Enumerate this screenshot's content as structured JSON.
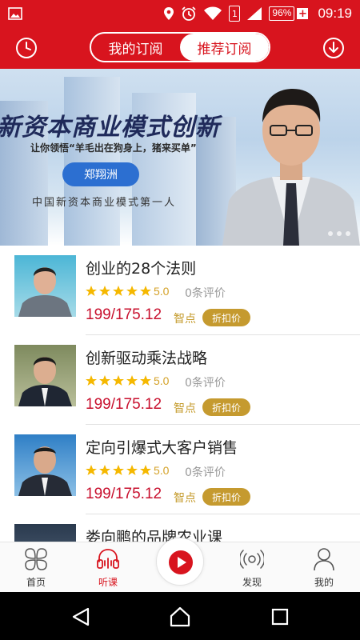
{
  "status_bar": {
    "battery": "96%",
    "battery_plus": "+",
    "sim": "1",
    "time": "09:19"
  },
  "header": {
    "tabs": {
      "mine": "我的订阅",
      "recommended": "推荐订阅"
    },
    "active_tab": "recommended",
    "left_icon": "clock-icon",
    "right_icon": "download-icon"
  },
  "banner": {
    "title": "新资本商业模式创新",
    "subtitle": "让你领悟“羊毛出在狗身上，猪来买单”",
    "speaker": "郑翔洲",
    "slogan": "中国新资本商业模式第一人",
    "slides": 3
  },
  "courses": [
    {
      "title": "创业的28个法则",
      "rating": "5.0",
      "stars": 5,
      "reviews": "0条评价",
      "price": "199/175.12",
      "unit": "智点",
      "badge": "折扣价"
    },
    {
      "title": "创新驱动乘法战略",
      "rating": "5.0",
      "stars": 5,
      "reviews": "0条评价",
      "price": "199/175.12",
      "unit": "智点",
      "badge": "折扣价"
    },
    {
      "title": "定向引爆式大客户销售",
      "rating": "5.0",
      "stars": 5,
      "reviews": "0条评价",
      "price": "199/175.12",
      "unit": "智点",
      "badge": "折扣价"
    },
    {
      "title": "娄向鹏的品牌农业课",
      "rating": "",
      "stars": 0,
      "reviews": "",
      "price": "",
      "unit": "",
      "badge": ""
    }
  ],
  "tab_bar": {
    "items": [
      {
        "label": "首页",
        "icon": "home-grid-icon"
      },
      {
        "label": "听课",
        "icon": "headphones-icon"
      },
      {
        "label": "",
        "icon": "play-icon"
      },
      {
        "label": "发现",
        "icon": "discover-icon"
      },
      {
        "label": "我的",
        "icon": "user-icon"
      }
    ],
    "active": "听课"
  },
  "colors": {
    "brand_red": "#d8141e",
    "price_red": "#c8102e",
    "gold": "#c59a2f",
    "star": "#f5b800"
  }
}
